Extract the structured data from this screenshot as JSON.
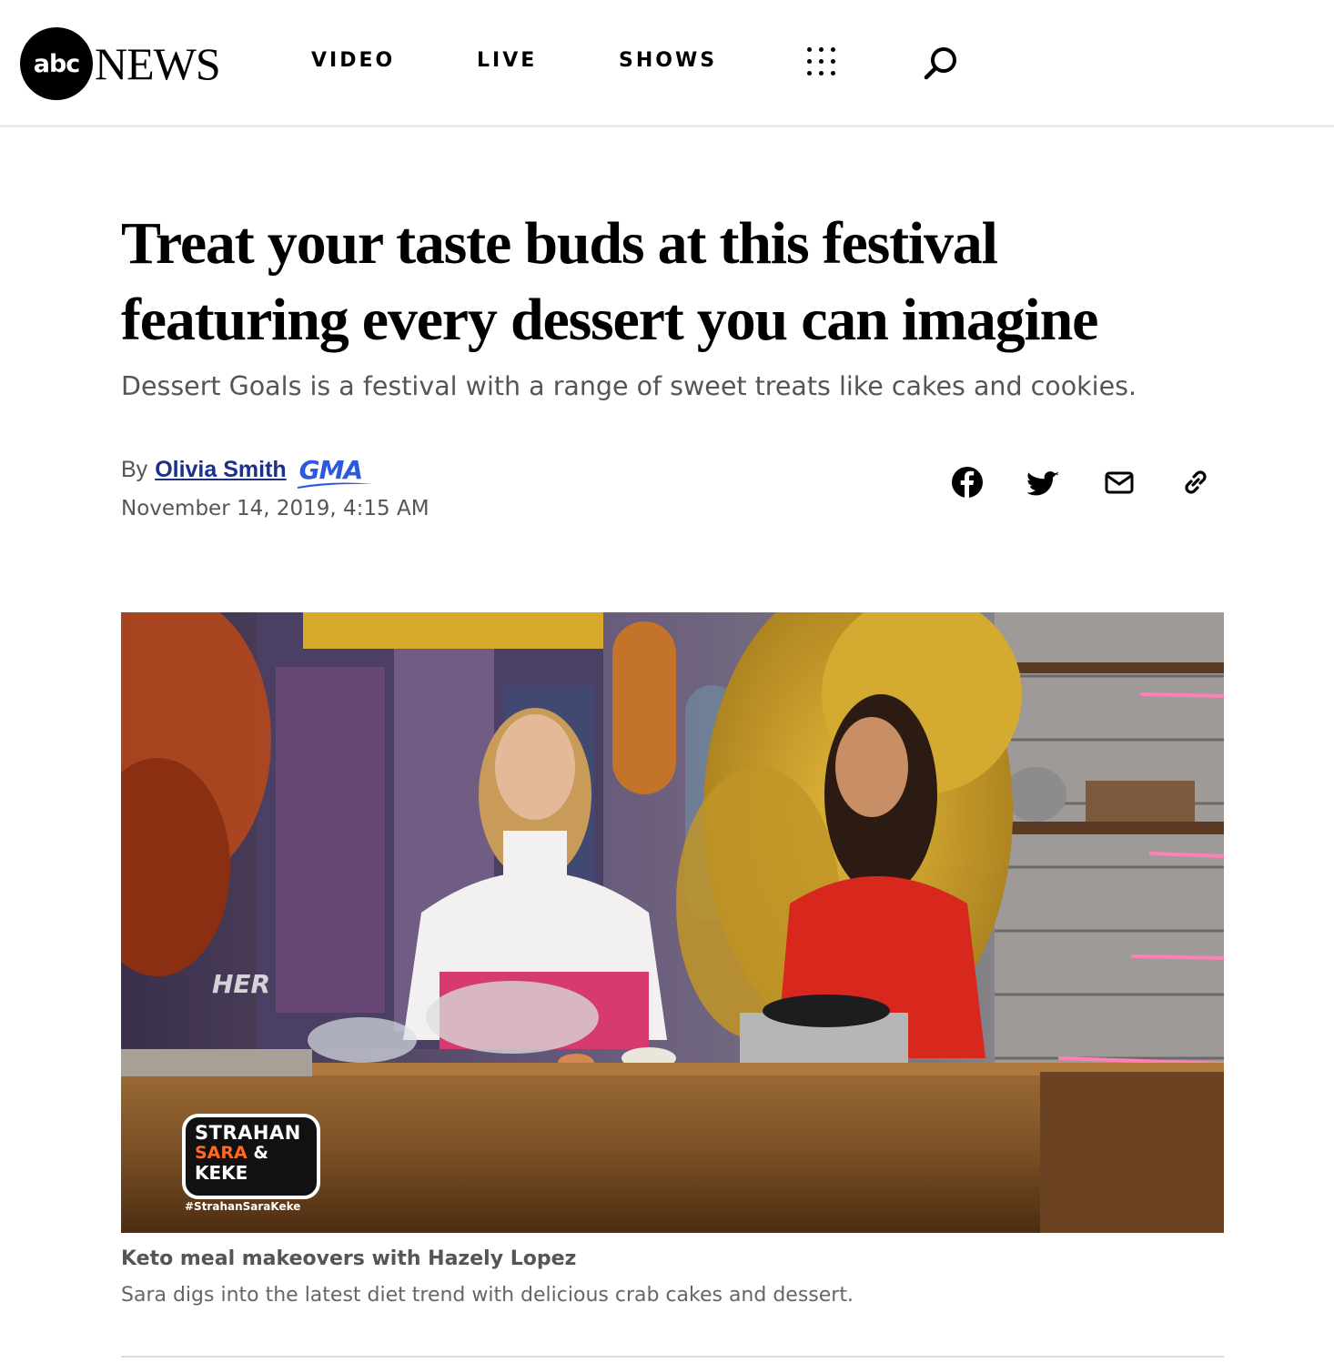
{
  "header": {
    "logo_abc": "abc",
    "logo_news": "NEWS",
    "nav": [
      "VIDEO",
      "LIVE",
      "SHOWS"
    ]
  },
  "article": {
    "headline": "Treat your taste buds at this festival featuring every dessert you can imagine",
    "subhead": "Dessert Goals is a festival with a range of sweet treats like cakes and cookies.",
    "byline_prefix": "By",
    "author": "Olivia Smith",
    "source_logo": "GMA",
    "timestamp": "November 14, 2019, 4:15 AM"
  },
  "share_icons": [
    "facebook-icon",
    "twitter-icon",
    "email-icon",
    "link-icon"
  ],
  "hero": {
    "show_badge_line1": "STRAHAN",
    "show_badge_line2": "SARA",
    "show_badge_amp": "&",
    "show_badge_line3": "KEKE",
    "hashtag": "#StrahanSaraKeke",
    "signage": "HER"
  },
  "caption": {
    "title": "Keto meal makeovers with Hazely Lopez",
    "description": "Sara digs into the latest diet trend with delicious crab cakes and dessert."
  },
  "colors": {
    "author_link": "#1c2f8a",
    "gma_brand": "#2c59e0",
    "gray_text": "#555555"
  }
}
